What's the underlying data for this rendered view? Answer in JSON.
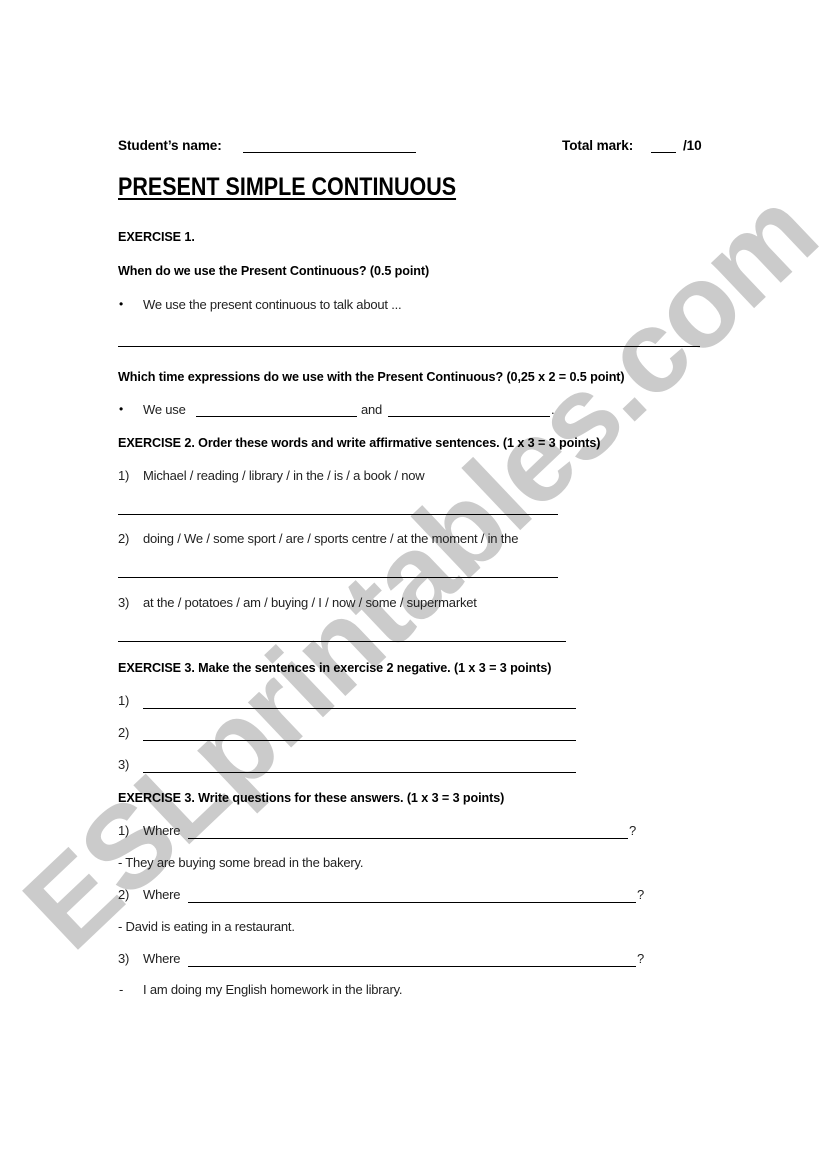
{
  "header": {
    "student_name_label": "Student’s name:",
    "total_mark_label": "Total mark:",
    "total_mark_max": "/10"
  },
  "title": "PRESENT SIMPLE CONTINUOUS",
  "watermark": "ESLprintables.com",
  "exercise1": {
    "heading": "EXERCISE 1.",
    "question1": "When do we use the Present Continuous? (0.5 point)",
    "bullet1": "We use the present continuous to talk about ...",
    "question2": "Which time expressions do we use with the Present Continuous? (0,25 x 2 = 0.5 point)",
    "bullet2_start": "We use",
    "bullet2_mid": "and",
    "bullet2_end": "."
  },
  "exercise2": {
    "heading": "EXERCISE 2. Order these words and write affirmative sentences. (1 x 3 = 3 points)",
    "items": [
      {
        "num": "1)",
        "text": "Michael / reading / library / in the / is / a book / now"
      },
      {
        "num": "2)",
        "text": "doing / We / some sport / are / sports centre / at the moment / in the"
      },
      {
        "num": "3)",
        "text": "at the / potatoes / am / buying / I / now / some / supermarket"
      }
    ]
  },
  "exercise3": {
    "heading": "EXERCISE 3. Make the sentences in exercise 2 negative. (1 x 3 = 3 points)",
    "items": [
      {
        "num": "1)"
      },
      {
        "num": "2)"
      },
      {
        "num": "3)"
      }
    ]
  },
  "exercise4": {
    "heading": "EXERCISE 3. Write questions for these answers. (1 x 3 = 3 points)",
    "items": [
      {
        "num": "1)",
        "prompt": "Where",
        "end": "?",
        "answer": "- They are buying some bread in the bakery."
      },
      {
        "num": "2)",
        "prompt": "Where",
        "end": "?",
        "answer": "- David is eating in a restaurant."
      },
      {
        "num": "3)",
        "prompt": "Where",
        "end": "?",
        "answer_dash": "-",
        "answer": "I am doing my English homework in the library."
      }
    ]
  }
}
